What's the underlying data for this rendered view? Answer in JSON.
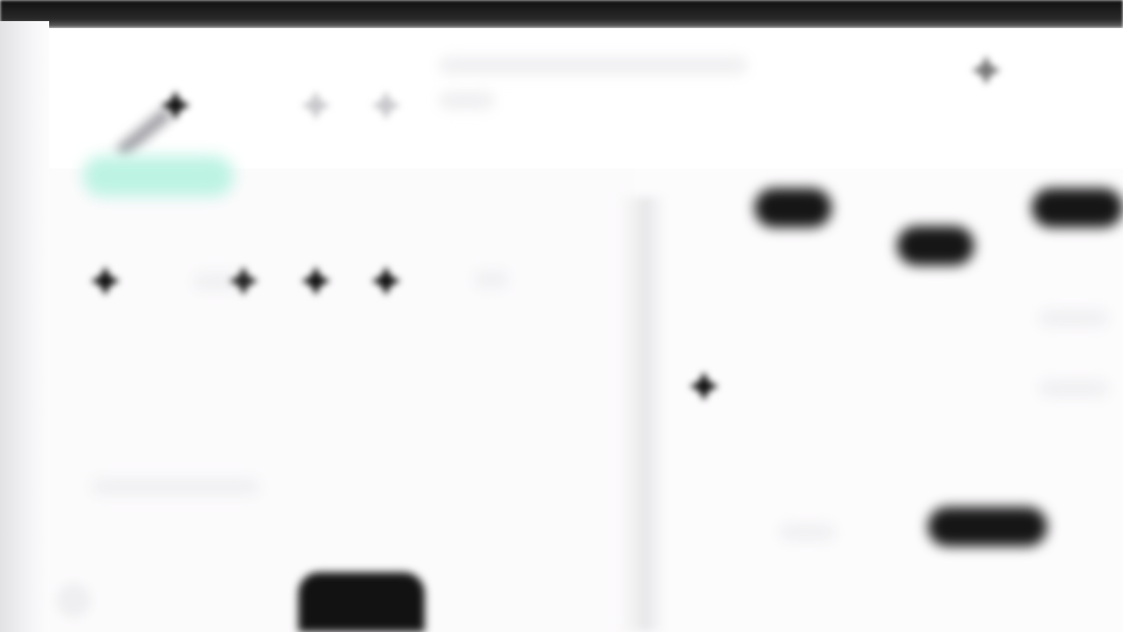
{
  "colors": {
    "title_bar": "#1a1a1a",
    "background": "#fdfcfd",
    "icon": "#111111",
    "icon_faded": "#c8c8cc",
    "accent_highlight": "#bdf3e3"
  },
  "toolbar": {
    "icons": [
      "pencil-icon",
      "sparkle-icon",
      "sparkle-icon",
      "sparkle-icon"
    ],
    "title_text": "",
    "top_right_icon": "sparkle-icon"
  },
  "left_panel": {
    "row_icons": [
      "sparkle-icon",
      "sparkle-icon",
      "sparkle-icon",
      "sparkle-icon",
      "sparkle-icon"
    ],
    "caption": ""
  },
  "right_panel": {
    "badges": [
      "",
      "",
      "",
      ""
    ],
    "marker_icon": "sparkle-icon"
  }
}
